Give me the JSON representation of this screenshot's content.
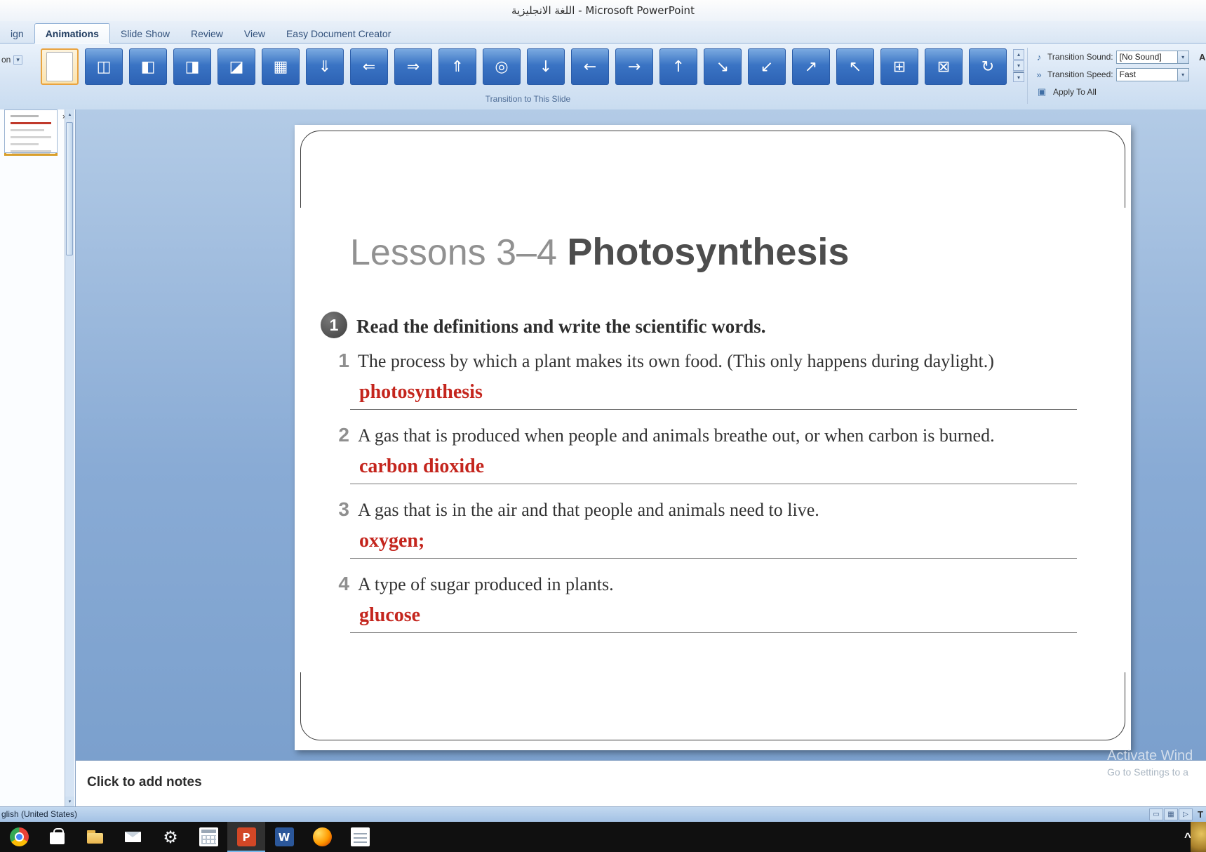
{
  "window": {
    "title": "اللغة الانجليزية - Microsoft PowerPoint"
  },
  "ribbon": {
    "tabs": [
      {
        "name": "ribbon-tab-design-partial",
        "label": "ign",
        "active": false
      },
      {
        "name": "ribbon-tab-animations",
        "label": "Animations",
        "active": true
      },
      {
        "name": "ribbon-tab-slide-show",
        "label": "Slide Show",
        "active": false
      },
      {
        "name": "ribbon-tab-review",
        "label": "Review",
        "active": false
      },
      {
        "name": "ribbon-tab-view",
        "label": "View",
        "active": false
      },
      {
        "name": "ribbon-tab-easy-document-creator",
        "label": "Easy Document Creator",
        "active": false
      }
    ],
    "left_partial": "on",
    "group_label": "Transition to This Slide",
    "right_partial": "A",
    "transitions": [
      {
        "name": "transition-no-transition",
        "glyph": "",
        "selected": true
      },
      {
        "name": "transition-fade-smoothly",
        "glyph": "◫",
        "selected": false
      },
      {
        "name": "transition-fade-through-black",
        "glyph": "◧",
        "selected": false
      },
      {
        "name": "transition-cut",
        "glyph": "◨",
        "selected": false
      },
      {
        "name": "transition-cut-through-black",
        "glyph": "◪",
        "selected": false
      },
      {
        "name": "transition-dissolve",
        "glyph": "▦",
        "selected": false
      },
      {
        "name": "transition-wipe-down",
        "glyph": "⇓",
        "selected": false
      },
      {
        "name": "transition-wipe-left",
        "glyph": "⇐",
        "selected": false
      },
      {
        "name": "transition-wipe-right",
        "glyph": "⇒",
        "selected": false
      },
      {
        "name": "transition-wipe-up",
        "glyph": "⇑",
        "selected": false
      },
      {
        "name": "transition-shape-circle",
        "glyph": "◎",
        "selected": false
      },
      {
        "name": "transition-push-down",
        "glyph": "↓",
        "selected": false
      },
      {
        "name": "transition-push-left",
        "glyph": "←",
        "selected": false
      },
      {
        "name": "transition-push-right",
        "glyph": "→",
        "selected": false
      },
      {
        "name": "transition-push-up",
        "glyph": "↑",
        "selected": false
      },
      {
        "name": "transition-cover-down-right",
        "glyph": "↘",
        "selected": false
      },
      {
        "name": "transition-cover-down-left",
        "glyph": "↙",
        "selected": false
      },
      {
        "name": "transition-cover-up-right",
        "glyph": "↗",
        "selected": false
      },
      {
        "name": "transition-cover-up-left",
        "glyph": "↖",
        "selected": false
      },
      {
        "name": "transition-strips-out",
        "glyph": "⊞",
        "selected": false
      },
      {
        "name": "transition-strips-in",
        "glyph": "⊠",
        "selected": false
      },
      {
        "name": "transition-random",
        "glyph": "↻",
        "selected": false
      }
    ],
    "sound": {
      "icon": "♪",
      "label": "Transition Sound:",
      "value": "[No Sound]"
    },
    "speed": {
      "icon": "»",
      "label": "Transition Speed:",
      "value": "Fast"
    },
    "apply": {
      "icon": "▣",
      "label": "Apply To All"
    },
    "scroll": {
      "up": "▴",
      "down": "▾",
      "more": "▾"
    }
  },
  "panel": {
    "close_icon": "×",
    "thumbnails": [
      {
        "name": "slide-thumbnail-1",
        "selected": false
      },
      {
        "name": "slide-thumbnail-2",
        "selected": false
      },
      {
        "name": "slide-thumbnail-3",
        "selected": true
      },
      {
        "name": "slide-thumbnail-4",
        "selected": false
      },
      {
        "name": "slide-thumbnail-5",
        "selected": false
      }
    ]
  },
  "slide": {
    "title_prefix": "Lessons 3–4 ",
    "title_main": "Photosynthesis",
    "exercise_number": "1",
    "exercise_instruction": "Read the definitions and write the scientific words.",
    "questions": [
      {
        "number": "1",
        "text": "The process by which a plant makes its own food. (This only happens during daylight.)",
        "answer": "photosynthesis"
      },
      {
        "number": "2",
        "text": "A gas that is produced when people and animals breathe out, or when carbon is burned.",
        "answer": "carbon dioxide"
      },
      {
        "number": "3",
        "text": "A gas that is in the air and that people and animals need to live.",
        "answer": "oxygen;"
      },
      {
        "number": "4",
        "text": "A type of sugar produced in plants.",
        "answer": "glucose"
      }
    ]
  },
  "notes": {
    "placeholder": "Click to add notes"
  },
  "watermark": {
    "line1": "Activate Wind",
    "line2": "Go to Settings to a"
  },
  "status_bar": {
    "language": "glish (United States)",
    "right_partial": "T",
    "view_buttons": [
      {
        "name": "normal-view-button",
        "glyph": "▭"
      },
      {
        "name": "slide-sorter-button",
        "glyph": "▦"
      },
      {
        "name": "slide-show-button",
        "glyph": "▷"
      }
    ]
  },
  "taskbar": {
    "chevron": "^",
    "icons": [
      {
        "name": "taskbar-icon-chrome",
        "kind": "ic-chrome",
        "glyph": "",
        "active": false
      },
      {
        "name": "taskbar-icon-microsoft-store",
        "kind": "ic-store",
        "glyph": "",
        "active": false
      },
      {
        "name": "taskbar-icon-file-explorer",
        "kind": "ic-folder",
        "glyph": "",
        "active": false
      },
      {
        "name": "taskbar-icon-mail",
        "kind": "ic-mail",
        "glyph": "",
        "active": false
      },
      {
        "name": "taskbar-icon-settings",
        "kind": "ic-gear",
        "glyph": "⚙",
        "active": false
      },
      {
        "name": "taskbar-icon-calculator",
        "kind": "ic-calc",
        "glyph": "",
        "active": false
      },
      {
        "name": "taskbar-icon-powerpoint",
        "kind": "ic-ppt",
        "glyph": "P",
        "active": true
      },
      {
        "name": "taskbar-icon-word",
        "kind": "ic-word",
        "glyph": "W",
        "active": false
      },
      {
        "name": "taskbar-icon-firefox",
        "kind": "ic-firefox",
        "glyph": "",
        "active": false
      },
      {
        "name": "taskbar-icon-text-document",
        "kind": "ic-doc",
        "glyph": "",
        "active": false
      }
    ]
  },
  "colors": {
    "selection_orange": "#e9a33f",
    "answer_red": "#c4251d",
    "powerpoint_orange": "#d24726",
    "word_blue": "#2b579a",
    "workspace_blue": "#89abd5"
  }
}
